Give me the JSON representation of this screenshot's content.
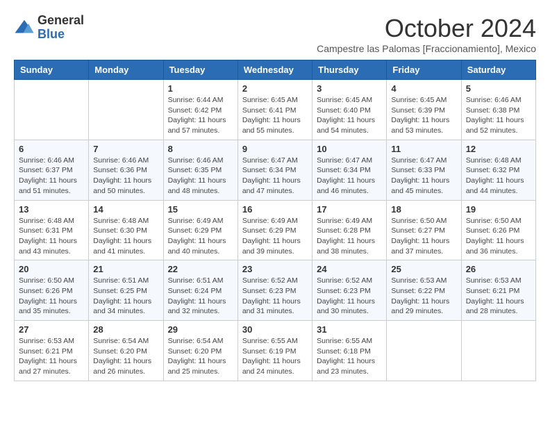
{
  "logo": {
    "general": "General",
    "blue": "Blue"
  },
  "title": {
    "month": "October 2024",
    "location": "Campestre las Palomas [Fraccionamiento], Mexico"
  },
  "days_of_week": [
    "Sunday",
    "Monday",
    "Tuesday",
    "Wednesday",
    "Thursday",
    "Friday",
    "Saturday"
  ],
  "weeks": [
    [
      {
        "day": "",
        "sunrise": "",
        "sunset": "",
        "daylight": ""
      },
      {
        "day": "",
        "sunrise": "",
        "sunset": "",
        "daylight": ""
      },
      {
        "day": "1",
        "sunrise": "Sunrise: 6:44 AM",
        "sunset": "Sunset: 6:42 PM",
        "daylight": "Daylight: 11 hours and 57 minutes."
      },
      {
        "day": "2",
        "sunrise": "Sunrise: 6:45 AM",
        "sunset": "Sunset: 6:41 PM",
        "daylight": "Daylight: 11 hours and 55 minutes."
      },
      {
        "day": "3",
        "sunrise": "Sunrise: 6:45 AM",
        "sunset": "Sunset: 6:40 PM",
        "daylight": "Daylight: 11 hours and 54 minutes."
      },
      {
        "day": "4",
        "sunrise": "Sunrise: 6:45 AM",
        "sunset": "Sunset: 6:39 PM",
        "daylight": "Daylight: 11 hours and 53 minutes."
      },
      {
        "day": "5",
        "sunrise": "Sunrise: 6:46 AM",
        "sunset": "Sunset: 6:38 PM",
        "daylight": "Daylight: 11 hours and 52 minutes."
      }
    ],
    [
      {
        "day": "6",
        "sunrise": "Sunrise: 6:46 AM",
        "sunset": "Sunset: 6:37 PM",
        "daylight": "Daylight: 11 hours and 51 minutes."
      },
      {
        "day": "7",
        "sunrise": "Sunrise: 6:46 AM",
        "sunset": "Sunset: 6:36 PM",
        "daylight": "Daylight: 11 hours and 50 minutes."
      },
      {
        "day": "8",
        "sunrise": "Sunrise: 6:46 AM",
        "sunset": "Sunset: 6:35 PM",
        "daylight": "Daylight: 11 hours and 48 minutes."
      },
      {
        "day": "9",
        "sunrise": "Sunrise: 6:47 AM",
        "sunset": "Sunset: 6:34 PM",
        "daylight": "Daylight: 11 hours and 47 minutes."
      },
      {
        "day": "10",
        "sunrise": "Sunrise: 6:47 AM",
        "sunset": "Sunset: 6:34 PM",
        "daylight": "Daylight: 11 hours and 46 minutes."
      },
      {
        "day": "11",
        "sunrise": "Sunrise: 6:47 AM",
        "sunset": "Sunset: 6:33 PM",
        "daylight": "Daylight: 11 hours and 45 minutes."
      },
      {
        "day": "12",
        "sunrise": "Sunrise: 6:48 AM",
        "sunset": "Sunset: 6:32 PM",
        "daylight": "Daylight: 11 hours and 44 minutes."
      }
    ],
    [
      {
        "day": "13",
        "sunrise": "Sunrise: 6:48 AM",
        "sunset": "Sunset: 6:31 PM",
        "daylight": "Daylight: 11 hours and 43 minutes."
      },
      {
        "day": "14",
        "sunrise": "Sunrise: 6:48 AM",
        "sunset": "Sunset: 6:30 PM",
        "daylight": "Daylight: 11 hours and 41 minutes."
      },
      {
        "day": "15",
        "sunrise": "Sunrise: 6:49 AM",
        "sunset": "Sunset: 6:29 PM",
        "daylight": "Daylight: 11 hours and 40 minutes."
      },
      {
        "day": "16",
        "sunrise": "Sunrise: 6:49 AM",
        "sunset": "Sunset: 6:29 PM",
        "daylight": "Daylight: 11 hours and 39 minutes."
      },
      {
        "day": "17",
        "sunrise": "Sunrise: 6:49 AM",
        "sunset": "Sunset: 6:28 PM",
        "daylight": "Daylight: 11 hours and 38 minutes."
      },
      {
        "day": "18",
        "sunrise": "Sunrise: 6:50 AM",
        "sunset": "Sunset: 6:27 PM",
        "daylight": "Daylight: 11 hours and 37 minutes."
      },
      {
        "day": "19",
        "sunrise": "Sunrise: 6:50 AM",
        "sunset": "Sunset: 6:26 PM",
        "daylight": "Daylight: 11 hours and 36 minutes."
      }
    ],
    [
      {
        "day": "20",
        "sunrise": "Sunrise: 6:50 AM",
        "sunset": "Sunset: 6:26 PM",
        "daylight": "Daylight: 11 hours and 35 minutes."
      },
      {
        "day": "21",
        "sunrise": "Sunrise: 6:51 AM",
        "sunset": "Sunset: 6:25 PM",
        "daylight": "Daylight: 11 hours and 34 minutes."
      },
      {
        "day": "22",
        "sunrise": "Sunrise: 6:51 AM",
        "sunset": "Sunset: 6:24 PM",
        "daylight": "Daylight: 11 hours and 32 minutes."
      },
      {
        "day": "23",
        "sunrise": "Sunrise: 6:52 AM",
        "sunset": "Sunset: 6:23 PM",
        "daylight": "Daylight: 11 hours and 31 minutes."
      },
      {
        "day": "24",
        "sunrise": "Sunrise: 6:52 AM",
        "sunset": "Sunset: 6:23 PM",
        "daylight": "Daylight: 11 hours and 30 minutes."
      },
      {
        "day": "25",
        "sunrise": "Sunrise: 6:53 AM",
        "sunset": "Sunset: 6:22 PM",
        "daylight": "Daylight: 11 hours and 29 minutes."
      },
      {
        "day": "26",
        "sunrise": "Sunrise: 6:53 AM",
        "sunset": "Sunset: 6:21 PM",
        "daylight": "Daylight: 11 hours and 28 minutes."
      }
    ],
    [
      {
        "day": "27",
        "sunrise": "Sunrise: 6:53 AM",
        "sunset": "Sunset: 6:21 PM",
        "daylight": "Daylight: 11 hours and 27 minutes."
      },
      {
        "day": "28",
        "sunrise": "Sunrise: 6:54 AM",
        "sunset": "Sunset: 6:20 PM",
        "daylight": "Daylight: 11 hours and 26 minutes."
      },
      {
        "day": "29",
        "sunrise": "Sunrise: 6:54 AM",
        "sunset": "Sunset: 6:20 PM",
        "daylight": "Daylight: 11 hours and 25 minutes."
      },
      {
        "day": "30",
        "sunrise": "Sunrise: 6:55 AM",
        "sunset": "Sunset: 6:19 PM",
        "daylight": "Daylight: 11 hours and 24 minutes."
      },
      {
        "day": "31",
        "sunrise": "Sunrise: 6:55 AM",
        "sunset": "Sunset: 6:18 PM",
        "daylight": "Daylight: 11 hours and 23 minutes."
      },
      {
        "day": "",
        "sunrise": "",
        "sunset": "",
        "daylight": ""
      },
      {
        "day": "",
        "sunrise": "",
        "sunset": "",
        "daylight": ""
      }
    ]
  ]
}
